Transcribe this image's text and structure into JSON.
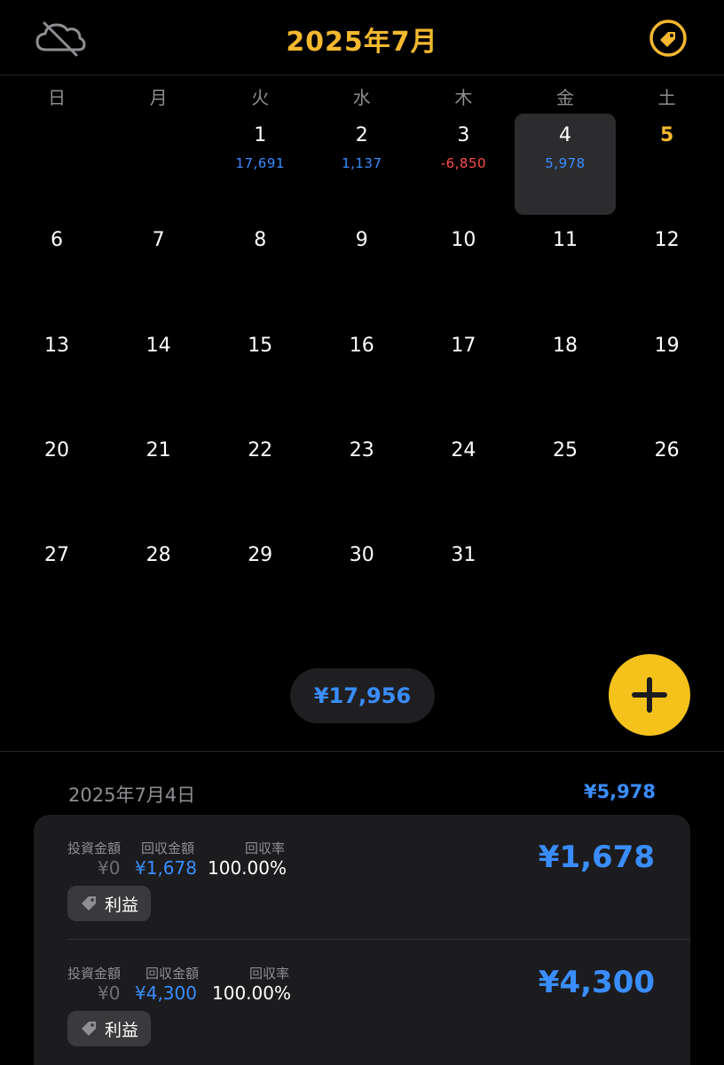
{
  "header": {
    "title": "2025年7月",
    "left_icon": "cloud-off-icon",
    "right_icon": "tag-icon"
  },
  "colors": {
    "accent": "#f5b82e",
    "positive": "#3a8dff",
    "negative": "#ff4d4d",
    "fab": "#f5c21b"
  },
  "weekdays": [
    "日",
    "月",
    "火",
    "水",
    "木",
    "金",
    "土"
  ],
  "days": [
    {
      "num": "1",
      "amount": "17,691",
      "sign": "pos"
    },
    {
      "num": "2",
      "amount": "1,137",
      "sign": "pos"
    },
    {
      "num": "3",
      "amount": "-6,850",
      "sign": "neg"
    },
    {
      "num": "4",
      "amount": "5,978",
      "sign": "pos",
      "selected": true
    },
    {
      "num": "5",
      "amount": "",
      "today": true
    },
    {
      "num": "6"
    },
    {
      "num": "7"
    },
    {
      "num": "8"
    },
    {
      "num": "9"
    },
    {
      "num": "10"
    },
    {
      "num": "11"
    },
    {
      "num": "12"
    },
    {
      "num": "13"
    },
    {
      "num": "14"
    },
    {
      "num": "15"
    },
    {
      "num": "16"
    },
    {
      "num": "17"
    },
    {
      "num": "18"
    },
    {
      "num": "19"
    },
    {
      "num": "20"
    },
    {
      "num": "21"
    },
    {
      "num": "22"
    },
    {
      "num": "23"
    },
    {
      "num": "24"
    },
    {
      "num": "25"
    },
    {
      "num": "26"
    },
    {
      "num": "27"
    },
    {
      "num": "28"
    },
    {
      "num": "29"
    },
    {
      "num": "30"
    },
    {
      "num": "31"
    }
  ],
  "first_weekday_index": 2,
  "month_total": "¥17,956",
  "fab_icon": "plus-icon",
  "detail": {
    "date": "2025年7月4日",
    "total": "¥5,978",
    "entries": [
      {
        "invest_label": "投資金額",
        "return_label": "回収金額",
        "rate_label": "回収率",
        "invest_value": "¥0",
        "return_value": "¥1,678",
        "rate_value": "100.00%",
        "amount": "¥1,678",
        "tag": "利益"
      },
      {
        "invest_label": "投資金額",
        "return_label": "回収金額",
        "rate_label": "回収率",
        "invest_value": "¥0",
        "return_value": "¥4,300",
        "rate_value": "100.00%",
        "amount": "¥4,300",
        "tag": "利益"
      }
    ]
  }
}
